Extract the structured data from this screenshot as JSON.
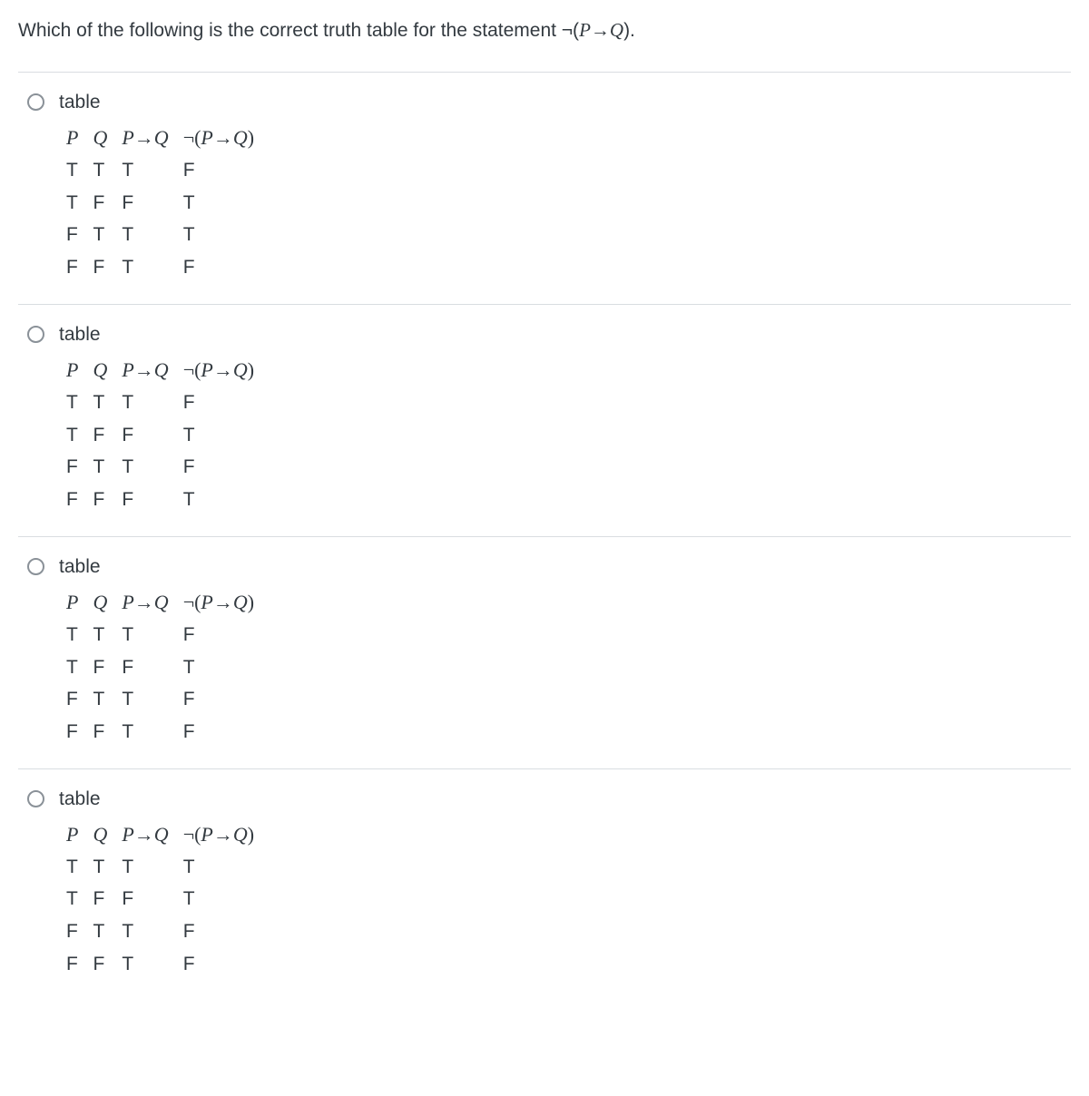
{
  "question_prefix": "Which of the following is the correct truth table for the statement ",
  "question_formula_neg": "¬(",
  "question_formula_p": "P",
  "question_formula_arrow": "→",
  "question_formula_q": "Q",
  "question_formula_close": ").",
  "labels": {
    "table": "table",
    "P": "P",
    "Q": "Q",
    "PimpQ_p": "P",
    "PimpQ_arrow": "→",
    "PimpQ_q": "Q",
    "neg_open": "¬(",
    "neg_p": "P",
    "neg_arrow": "→",
    "neg_q": "Q",
    "neg_close": ")"
  },
  "options": [
    {
      "rows": [
        [
          "T",
          "T",
          "T",
          "F"
        ],
        [
          "T",
          "F",
          "F",
          "T"
        ],
        [
          "F",
          "T",
          "T",
          "T"
        ],
        [
          "F",
          "F",
          "T",
          "F"
        ]
      ]
    },
    {
      "rows": [
        [
          "T",
          "T",
          "T",
          "F"
        ],
        [
          "T",
          "F",
          "F",
          "T"
        ],
        [
          "F",
          "T",
          "T",
          "F"
        ],
        [
          "F",
          "F",
          "F",
          "T"
        ]
      ]
    },
    {
      "rows": [
        [
          "T",
          "T",
          "T",
          "F"
        ],
        [
          "T",
          "F",
          "F",
          "T"
        ],
        [
          "F",
          "T",
          "T",
          "F"
        ],
        [
          "F",
          "F",
          "T",
          "F"
        ]
      ]
    },
    {
      "rows": [
        [
          "T",
          "T",
          "T",
          "T"
        ],
        [
          "T",
          "F",
          "F",
          "T"
        ],
        [
          "F",
          "T",
          "T",
          "F"
        ],
        [
          "F",
          "F",
          "T",
          "F"
        ]
      ]
    }
  ]
}
